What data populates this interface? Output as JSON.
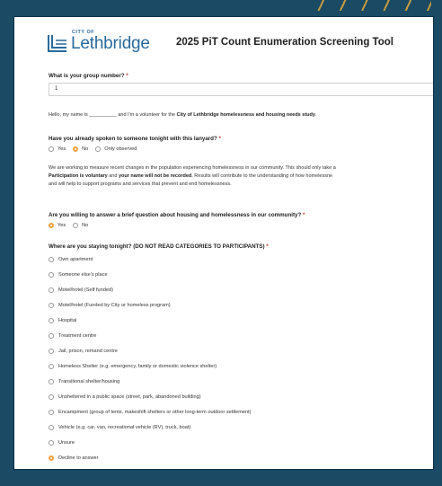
{
  "header": {
    "logo_small": "CITY OF",
    "logo_name": "Lethbridge",
    "title": "2025 PiT Count Enumeration Screening Tool"
  },
  "group": {
    "question": "What is your group number?",
    "required_mark": "*",
    "value": "1"
  },
  "intro": {
    "before": "Hello, my name is __________ and I'm a volunteer for the ",
    "bold": "City of Lethbridge homelessness and housing needs study",
    "after": "."
  },
  "lanyard": {
    "question": "Have you already spoken to someone tonight with this lanyard?",
    "required_mark": "*",
    "options": [
      "Yes",
      "No",
      "Only observed"
    ],
    "selected": "No"
  },
  "info": {
    "line1": "We are working to measure recent changes in the population experiencing homelessness in our community. This should only take a",
    "line2_bold1": "Participation is voluntary",
    "line2_mid": " and ",
    "line2_bold2": "your name will not be recorded",
    "line2_after": ". Results will contribute to the understanding of how homelessne",
    "line3": "and will help to support programs and services that prevent and end homelessness."
  },
  "willing": {
    "question": "Are you willing to answer a brief question about housing and homelessness in our community?",
    "required_mark": "*",
    "options": [
      "Yes",
      "No"
    ],
    "selected": "Yes"
  },
  "staying": {
    "question": "Where are you staying tonight? (DO NOT READ CATEGORIES TO PARTICIPANTS)",
    "required_mark": "*",
    "options": [
      "Own apartment",
      "Someone else's place",
      "Motel/hotel (Self funded)",
      "Motel/hotel (Funded by City or homeless program)",
      "Hospital",
      "Treatment centre",
      "Jail, prison, remand centre",
      "Homeless Shelter (e.g. emergency, family or domestic violence shelter)",
      "Transitional shelter/housing",
      "Unsheltered in a public space (street, park, abandoned building)",
      "Encampment (group of tents, makeshift shelters or other long-term outdoor settlement)",
      "Vehicle (e.g. car, van, recreational vehicle (RV), truck, boat)",
      "Unsure",
      "Decline to answer"
    ],
    "selected": "Decline to answer"
  },
  "colors": {
    "background": "#1a4a64",
    "brand_blue": "#2a6a9c",
    "accent_stripes": "#d9a23a",
    "radio_selected": "#f0a040",
    "required": "#c0392b"
  }
}
